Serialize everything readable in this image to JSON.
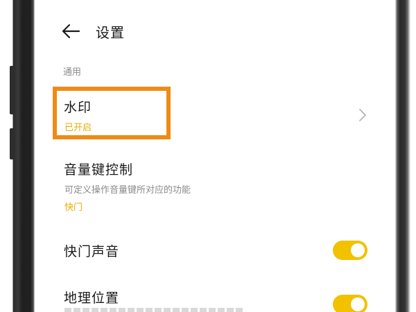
{
  "header": {
    "title": "设置"
  },
  "section": {
    "label": "通用"
  },
  "items": {
    "watermark": {
      "title": "水印",
      "value": "已开启"
    },
    "volume_key": {
      "title": "音量键控制",
      "description": "可定义操作音量键所对应的功能",
      "value": "快门"
    },
    "shutter_sound": {
      "title": "快门声音",
      "toggle_on": true
    },
    "location": {
      "title": "地理位置",
      "toggle_on": true
    }
  },
  "colors": {
    "accent": "#f2c100",
    "value_text": "#e6ad00",
    "highlight": "#f08a14"
  }
}
